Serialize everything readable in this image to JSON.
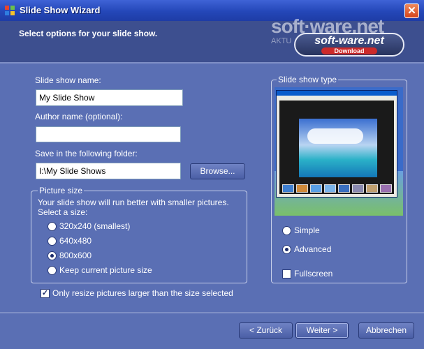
{
  "window": {
    "title": "Slide Show Wizard",
    "close_label": "✕"
  },
  "header": {
    "text": "Select options for your slide show."
  },
  "watermark": {
    "line1": "soft·ware.net",
    "line2": "AKTU",
    "badge_main": "soft-ware.net",
    "badge_sub": "Download"
  },
  "form": {
    "name_label": "Slide show name:",
    "name_value": "My Slide Show",
    "author_label": "Author name (optional):",
    "author_value": "",
    "folder_label": "Save in the following folder:",
    "folder_value": "I:\\My Slide Shows",
    "browse_label": "Browse..."
  },
  "picture_size": {
    "title": "Picture size",
    "desc1": "Your slide show will run better with smaller pictures.",
    "desc2": "Select a size:",
    "options": [
      "320x240 (smallest)",
      "640x480",
      "800x600",
      "Keep current picture size"
    ],
    "selected": "800x600"
  },
  "resize_checkbox": {
    "label": "Only resize pictures larger than the size selected",
    "checked": true
  },
  "slide_type": {
    "title": "Slide show type",
    "options": [
      "Simple",
      "Advanced"
    ],
    "selected": "Advanced",
    "fullscreen_label": "Fullscreen",
    "fullscreen_checked": false
  },
  "buttons": {
    "back": "< Zurück",
    "next": "Weiter >",
    "cancel": "Abbrechen"
  },
  "colors": {
    "background": "#5a6fb4",
    "titlebar": "#2447b8",
    "close": "#d5441a"
  }
}
